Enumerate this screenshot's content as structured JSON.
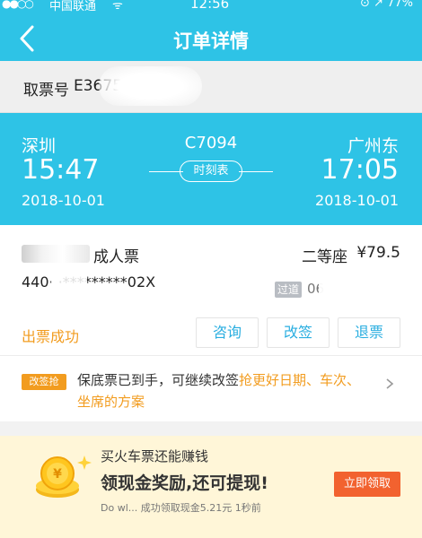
{
  "status_bar": {
    "signal": "●●○○",
    "carrier": "中国联通",
    "wifi": "ᯤ",
    "time": "12:56",
    "right": "⊙ ↗ 77%"
  },
  "header": {
    "title": "订单详情",
    "back_icon": "chevron-left-icon"
  },
  "ticket_pickup": {
    "label": "取票号",
    "value": "E3675"
  },
  "trip": {
    "from_station": "深圳",
    "to_station": "广州东",
    "train_number": "C7094",
    "depart_time": "15:47",
    "arrive_time": "17:05",
    "depart_date": "2018-10-01",
    "arrive_date": "2018-10-01",
    "schedule_label": "时刻表"
  },
  "passenger": {
    "ticket_type": "成人票",
    "seat_class": "二等座",
    "price": "¥79.5",
    "id_number": "440·  ·*********02X",
    "gate_tag": "过道",
    "gate_value": "06",
    "status": "出票成功",
    "buttons": [
      "咨询",
      "改签",
      "退票"
    ]
  },
  "guarantee_promo": {
    "tag": "改签抢",
    "text_plain": "保底票已到手，可继续改签",
    "text_highlight": "抢更好日期、车次、坐席的方案"
  },
  "cash_promo": {
    "line1": "买火车票还能赚钱",
    "line2": "领现金奖励,还可提现!",
    "line3": "Do wl... 成功领取现金5.21元 1秒前",
    "button": "立即领取"
  },
  "colors": {
    "primary": "#2ec3e6",
    "accent": "#f29c1f",
    "link": "#2aaee0",
    "cta": "#f2622f"
  }
}
